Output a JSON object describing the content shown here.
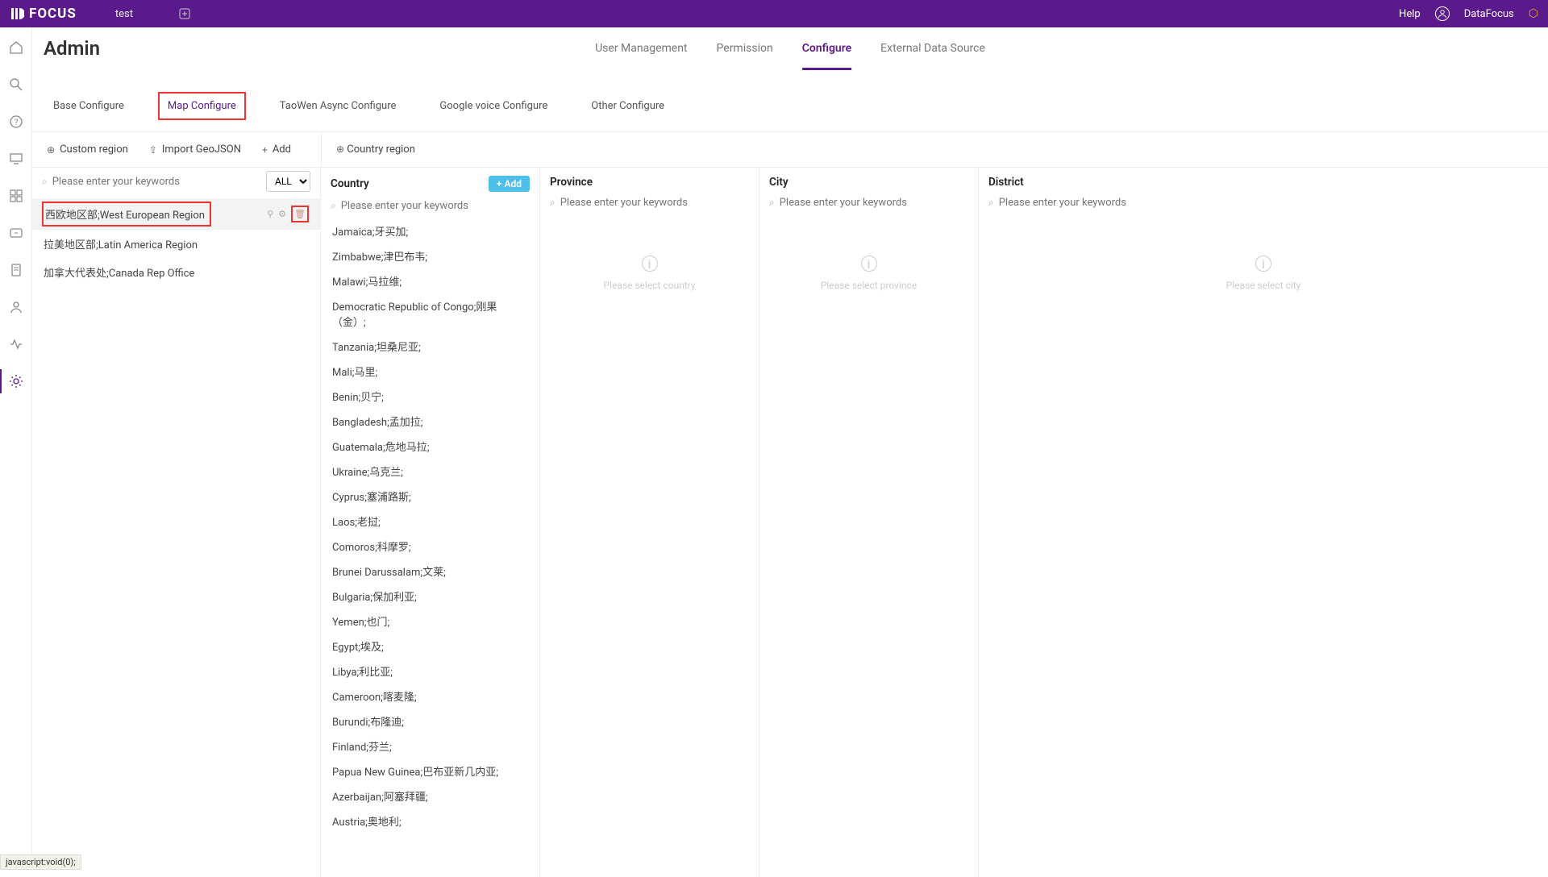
{
  "topbar": {
    "brand": "FOCUS",
    "tab": "test",
    "help": "Help",
    "user": "DataFocus"
  },
  "page": {
    "title": "Admin"
  },
  "main_tabs": [
    {
      "label": "User Management"
    },
    {
      "label": "Permission"
    },
    {
      "label": "Configure",
      "active": true
    },
    {
      "label": "External Data Source"
    }
  ],
  "sub_tabs": [
    {
      "label": "Base Configure"
    },
    {
      "label": "Map Configure",
      "highlighted": true
    },
    {
      "label": "TaoWen Async Configure"
    },
    {
      "label": "Google voice Configure"
    },
    {
      "label": "Other Configure"
    }
  ],
  "toolbar": {
    "custom_region": "Custom region",
    "import": "Import GeoJSON",
    "add": "Add",
    "country_region": "Country region"
  },
  "search": {
    "placeholder": "Please enter your keywords",
    "filter": "ALL"
  },
  "regions": [
    {
      "label": "西欧地区部;West European Region",
      "selected": true,
      "highlighted": true
    },
    {
      "label": "拉美地区部;Latin America Region"
    },
    {
      "label": "加拿大代表处;Canada Rep Office"
    }
  ],
  "columns": {
    "country": {
      "label": "Country",
      "add": "Add"
    },
    "province": {
      "label": "Province",
      "empty": "Please select country"
    },
    "city": {
      "label": "City",
      "empty": "Please select province"
    },
    "district": {
      "label": "District",
      "empty": "Please select city"
    }
  },
  "countries": [
    "Jamaica;牙买加;",
    "Zimbabwe;津巴布韦;",
    "Malawi;马拉维;",
    "Democratic Republic of Congo;刚果（金）;",
    "Tanzania;坦桑尼亚;",
    "Mali;马里;",
    "Benin;贝宁;",
    "Bangladesh;孟加拉;",
    "Guatemala;危地马拉;",
    "Ukraine;乌克兰;",
    "Cyprus;塞浦路斯;",
    "Laos;老挝;",
    "Comoros;科摩罗;",
    "Brunei Darussalam;文莱;",
    "Bulgaria;保加利亚;",
    "Yemen;也门;",
    "Egypt;埃及;",
    "Libya;利比亚;",
    "Cameroon;喀麦隆;",
    "Burundi;布隆迪;",
    "Finland;芬兰;",
    "Papua New Guinea;巴布亚新几内亚;",
    "Azerbaijan;阿塞拜疆;",
    "Austria;奥地利;"
  ],
  "status": "javascript:void(0);"
}
